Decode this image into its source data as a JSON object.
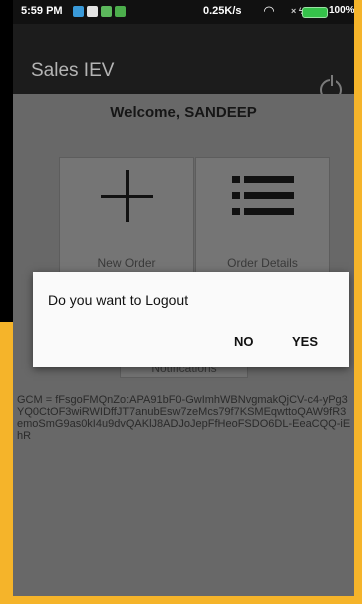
{
  "status_bar": {
    "time": "5:59 PM",
    "network_speed": "0.25K/s",
    "wifi_icon": "wifi-icon",
    "signal_glyph": "× ϟ",
    "battery_percent": "100%",
    "battery_level": 1.0,
    "battery_color": "#35c24a"
  },
  "app_bar": {
    "title": "Sales IEV",
    "power_icon": "power-icon"
  },
  "main": {
    "welcome": "Welcome, SANDEEP",
    "tiles": [
      {
        "label": "New Order",
        "icon": "plus-icon"
      },
      {
        "label": "Order Details",
        "icon": "list-icon"
      }
    ],
    "notifications_label": "Notifications",
    "gcm_text": "GCM = fFsgoFMQnZo:APA91bF0-GwImhWBNvgmakQjCV-c4-yPg3YQ0CtOF3wiRWIDffJT7anubEsw7zeMcs79f7KSMEqwttoQAW9fR3emoSmG9as0kI4u9dvQAKlJ8ADJoJepFfHeoFSDO6DL-EeaCQQ-iEhR"
  },
  "dialog": {
    "message": "Do you want to Logout",
    "no_label": "NO",
    "yes_label": "YES"
  },
  "colors": {
    "accent_frame": "#f5b42a",
    "app_bar": "#1c1c1c",
    "dimmed_content": "#686868",
    "dialog_bg": "#fafafa"
  }
}
